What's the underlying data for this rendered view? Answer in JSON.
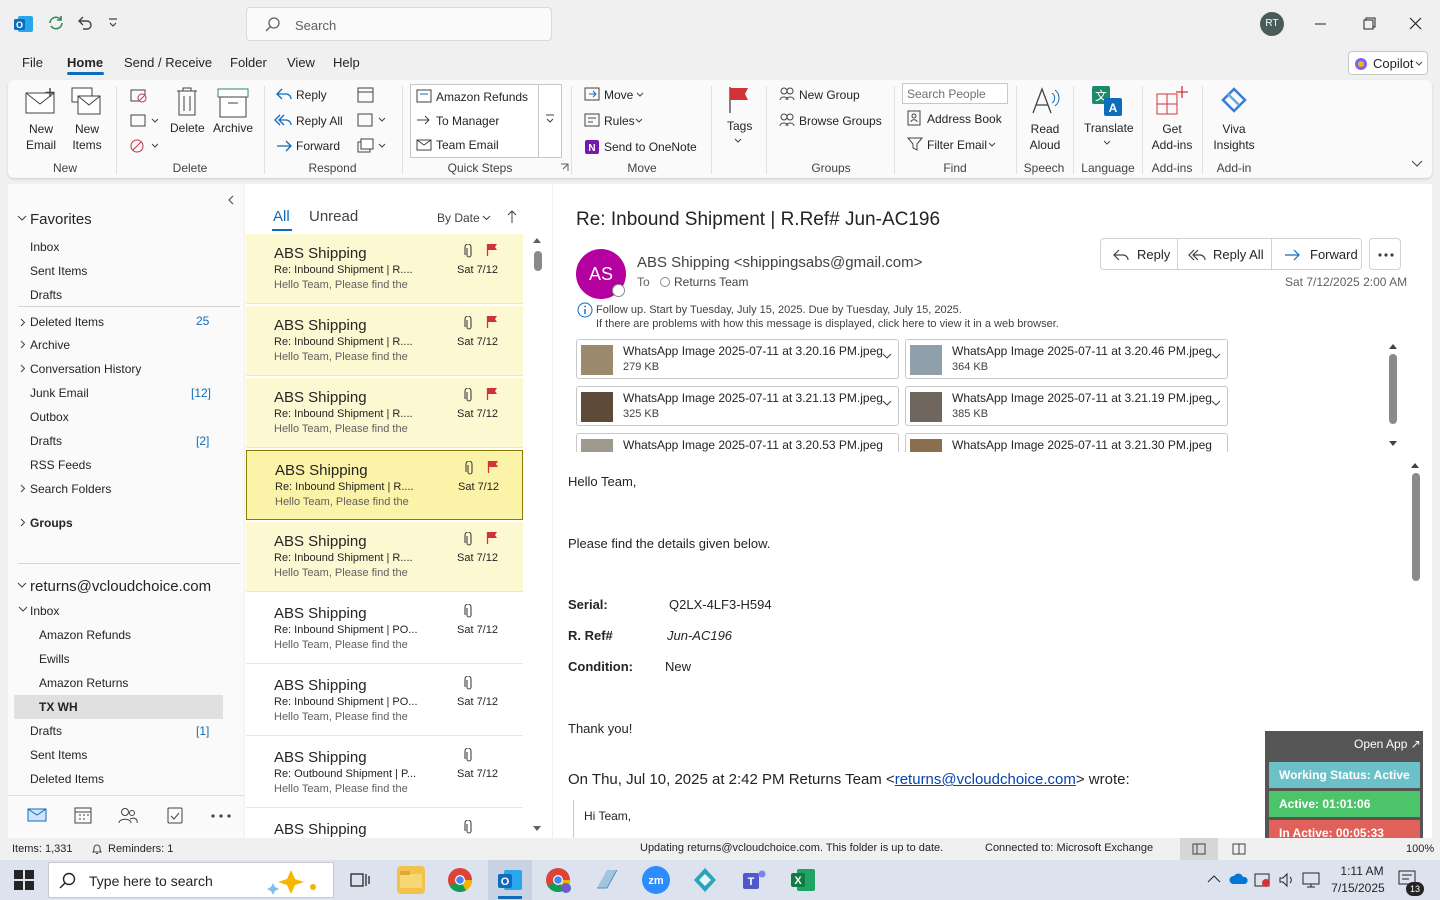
{
  "titlebar": {
    "search_placeholder": "Search",
    "avatar": "RT",
    "icons": [
      "outlook-logo-icon",
      "sync-icon",
      "undo-icon",
      "customize-icon",
      "minimize-icon",
      "restore-icon",
      "close-icon"
    ]
  },
  "menu": {
    "items": [
      "File",
      "Home",
      "Send / Receive",
      "Folder",
      "View",
      "Help"
    ],
    "active": "Home",
    "copilot": "Copilot"
  },
  "ribbon": {
    "new_email": "New\nEmail",
    "new_items": "New\nItems",
    "delete": "Delete",
    "archive": "Archive",
    "reply": "Reply",
    "reply_all": "Reply All",
    "forward": "Forward",
    "qs": [
      "Amazon Refunds",
      "To Manager",
      "Team Email"
    ],
    "move": "Move",
    "rules": "Rules",
    "onenote": "Send to OneNote",
    "tags": "Tags",
    "new_group": "New Group",
    "browse_groups": "Browse Groups",
    "search_people": "Search People",
    "address_book": "Address Book",
    "filter_email": "Filter Email",
    "read_aloud": "Read\nAloud",
    "translate": "Translate",
    "get_addins": "Get\nAdd-ins",
    "viva": "Viva\nInsights",
    "groups": [
      "New",
      "Delete",
      "Respond",
      "Quick Steps",
      "Move",
      "Groups",
      "Find",
      "Speech",
      "Language",
      "Add-ins",
      "Add-in"
    ]
  },
  "nav": {
    "favorites": "Favorites",
    "fav_items": [
      "Inbox",
      "Sent Items",
      "Drafts"
    ],
    "folders": [
      {
        "label": "Deleted Items",
        "count": "25"
      },
      {
        "label": "Archive",
        "count": ""
      },
      {
        "label": "Conversation History",
        "count": ""
      },
      {
        "label": "Junk Email",
        "count": "[12]"
      },
      {
        "label": "Outbox",
        "count": ""
      },
      {
        "label": "Drafts",
        "count": "[2]"
      },
      {
        "label": "RSS Feeds",
        "count": ""
      },
      {
        "label": "Search Folders",
        "count": ""
      }
    ],
    "groups": "Groups",
    "account": "returns@vcloudchoice.com",
    "inbox": "Inbox",
    "subfolders": [
      "Amazon Refunds",
      "Ewills",
      "Amazon Returns",
      "TX WH"
    ],
    "after": [
      {
        "label": "Drafts",
        "count": "[1]"
      },
      {
        "label": "Sent Items",
        "count": ""
      },
      {
        "label": "Deleted Items",
        "count": ""
      }
    ]
  },
  "list": {
    "tab_all": "All",
    "tab_unread": "Unread",
    "sort": "By Date",
    "messages": [
      {
        "from": "ABS Shipping",
        "subject": "Re: Inbound Shipment | R....",
        "preview": "Hello Team,  Please find the",
        "date": "Sat 7/12",
        "flag": true
      },
      {
        "from": "ABS Shipping",
        "subject": "Re: Inbound Shipment | R....",
        "preview": "Hello Team,  Please find the",
        "date": "Sat 7/12",
        "flag": true
      },
      {
        "from": "ABS Shipping",
        "subject": "Re: Inbound Shipment | R....",
        "preview": "Hello Team,  Please find the",
        "date": "Sat 7/12",
        "flag": true
      },
      {
        "from": "ABS Shipping",
        "subject": "Re: Inbound Shipment | R....",
        "preview": "Hello Team,  Please find the",
        "date": "Sat 7/12",
        "flag": true
      },
      {
        "from": "ABS Shipping",
        "subject": "Re: Inbound Shipment | R....",
        "preview": "Hello Team,  Please find the",
        "date": "Sat 7/12",
        "flag": true
      },
      {
        "from": "ABS Shipping",
        "subject": "Re: Inbound Shipment | PO...",
        "preview": "Hello Team,  Please find the",
        "date": "Sat 7/12",
        "flag": false
      },
      {
        "from": "ABS Shipping",
        "subject": "Re: Inbound Shipment | PO...",
        "preview": "Hello Team,  Please find the",
        "date": "Sat 7/12",
        "flag": false
      },
      {
        "from": "ABS Shipping",
        "subject": "Re: Outbound Shipment | P...",
        "preview": "Hello Team,  Please find the",
        "date": "Sat 7/12",
        "flag": false
      },
      {
        "from": "ABS Shipping",
        "subject": "",
        "preview": "",
        "date": "",
        "flag": false
      }
    ]
  },
  "email": {
    "subject": "Re: Inbound Shipment | R.Ref# Jun-AC196",
    "sender_initials": "AS",
    "sender": "ABS Shipping <shippingsabs@gmail.com>",
    "to_label": "To",
    "to": "Returns Team",
    "date": "Sat 7/12/2025 2:00 AM",
    "reply": "Reply",
    "reply_all": "Reply All",
    "forward": "Forward",
    "info1": "Follow up.  Start by Tuesday, July 15, 2025.  Due by Tuesday, July 15, 2025.",
    "info2": "If there are problems with how this message is displayed, click here to view it in a web browser.",
    "attachments": [
      {
        "name": "WhatsApp Image 2025-07-11 at 3.20.16 PM.jpeg",
        "size": "279 KB"
      },
      {
        "name": "WhatsApp Image 2025-07-11 at 3.20.46 PM.jpeg",
        "size": "364 KB"
      },
      {
        "name": "WhatsApp Image 2025-07-11 at 3.21.13 PM.jpeg",
        "size": "325 KB"
      },
      {
        "name": "WhatsApp Image 2025-07-11 at 3.21.19 PM.jpeg",
        "size": "385 KB"
      },
      {
        "name": "WhatsApp Image 2025-07-11 at 3.20.53 PM.jpeg",
        "size": ""
      },
      {
        "name": "WhatsApp Image 2025-07-11 at 3.21.30 PM.jpeg",
        "size": ""
      }
    ],
    "greeting": "Hello Team,",
    "intro": "Please find the details given below.",
    "serial_label": "Serial:",
    "serial": "Q2LX-4LF3-H594",
    "ref_label": "R. Ref#",
    "ref": "Jun-AC196",
    "cond_label": "Condition:",
    "cond": "New",
    "thanks": "Thank you!",
    "quote_prefix": "On Thu, Jul 10, 2025 at 2:42 PM Returns Team <",
    "quote_link": "returns@vcloudchoice.com",
    "quote_suffix": "> wrote:",
    "quote_body": "Hi Team,"
  },
  "widget": {
    "open": "Open App ↗",
    "status": "Working Status: Active",
    "active": "Active: 01:01:06",
    "inactive": "In Active: 00:05:33"
  },
  "status": {
    "items": "Items: 1,331",
    "reminders": "Reminders: 1",
    "updating": "Updating returns@vcloudchoice.com.  This folder is up to date.",
    "connected": "Connected to: Microsoft Exchange",
    "zoom": "100%"
  },
  "taskbar": {
    "search": "Type here to search",
    "time": "1:11 AM",
    "date": "7/15/2025",
    "notif": "13"
  },
  "colors": {
    "accent": "#0f6cbd",
    "flag": "#d13438",
    "avatar_sender": "#b4009e",
    "selected": "#fbf3a8",
    "widget_status": "#6cc0c8",
    "widget_active": "#4cc46a",
    "widget_inactive": "#e0605a"
  }
}
